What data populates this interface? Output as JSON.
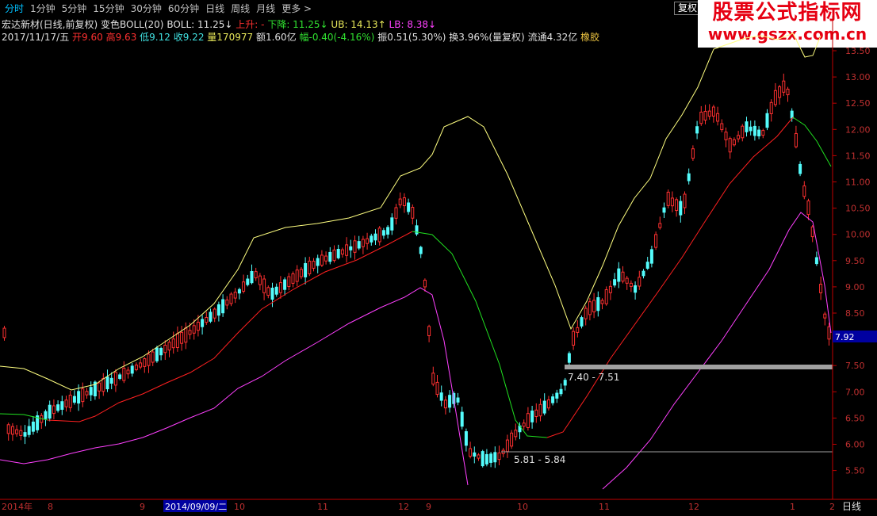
{
  "toolbar": {
    "items": [
      "分时",
      "1分钟",
      "5分钟",
      "15分钟",
      "30分钟",
      "60分钟",
      "日线",
      "周线",
      "月线",
      "更多 >"
    ],
    "fuquan_label": "复权"
  },
  "banner": {
    "title": "股票公式指标网",
    "url": "www.gszx.com.cn"
  },
  "indicator_line": {
    "stock": "宏达新材(日线,前复权)",
    "indicator": "变色BOLL(20)",
    "boll_label": "BOLL: 11.25",
    "up_label": "上升: -",
    "down_label": "下降: 11.25",
    "ub_label": "UB: 14.13",
    "lb_label": "LB: 8.38"
  },
  "quote_line": {
    "date": "2017/11/17/五",
    "open": "开9.60",
    "high": "高9.63",
    "low": "低9.12",
    "close": "收9.22",
    "volume": "量170977",
    "amount": "额1.60亿",
    "change": "幅-0.40(-4.16%)",
    "amplitude": "振0.51(5.30%)",
    "turnover": "换3.96%(量复权)",
    "float": "流通4.32亿",
    "concept": "橡胶"
  },
  "price_axis": {
    "ticks": [
      "13.50",
      "13.00",
      "12.50",
      "12.00",
      "11.50",
      "11.00",
      "10.50",
      "10.00",
      "9.50",
      "9.00",
      "8.50",
      "8.00",
      "7.50",
      "7.00",
      "6.50",
      "6.00",
      "5.50"
    ],
    "current_price": "7.92"
  },
  "zones": [
    {
      "label": "7.40 - 7.51"
    },
    {
      "label": "5.81 - 5.84"
    }
  ],
  "time_axis": {
    "labels": [
      "2014年",
      "8",
      "9",
      "2014/09/09/二",
      "10",
      "11",
      "12",
      "9",
      "10",
      "11",
      "12",
      "1",
      "2"
    ],
    "period_label": "日线"
  },
  "colors": {
    "up_candle": "#ff3030",
    "down_candle": "#54fcfc",
    "upper_band": "#ffff80",
    "mid_rising": "#ff2020",
    "mid_falling": "#20e020",
    "lower_band": "#ff40ff",
    "axis": "#c00000"
  }
}
